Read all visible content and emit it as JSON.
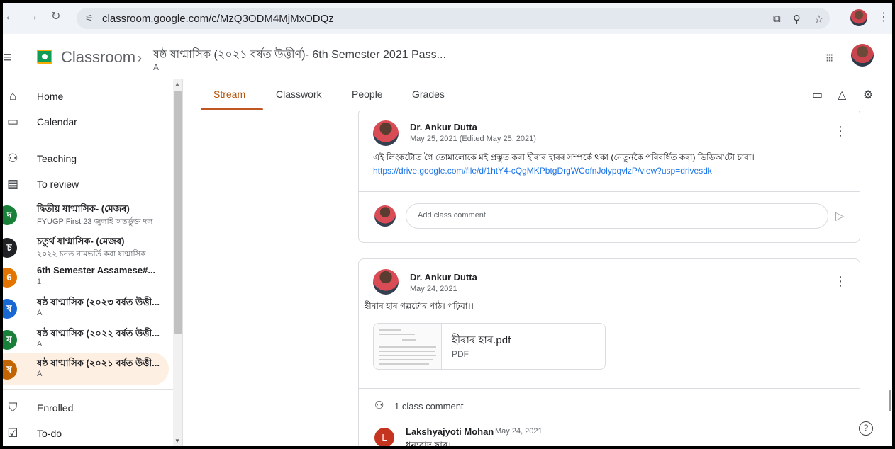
{
  "browser": {
    "url": "classroom.google.com/c/MzQ3ODM4MjMxODQz",
    "icons": [
      "back-icon",
      "forward-icon",
      "reload-icon",
      "site-info-icon",
      "cast-icon",
      "zoom-icon",
      "bookmark-star-icon",
      "profile-avatar",
      "menu-icon"
    ]
  },
  "header": {
    "app_title": "Classroom",
    "separator": "›",
    "class_title": "ষষ্ঠ ষাণ্মাসিক (২০২১ বৰ্ষত উত্তীৰ্ণ)- 6th Semester 2021 Pass...",
    "class_section": "A"
  },
  "sidebar": {
    "nav_top": [
      {
        "label": "Home",
        "icon": "home-icon"
      },
      {
        "label": "Calendar",
        "icon": "calendar-icon"
      }
    ],
    "teaching": {
      "label": "Teaching",
      "icon": "people-icon"
    },
    "to_review": {
      "label": "To review",
      "icon": "review-icon"
    },
    "classes": [
      {
        "letter": "দ",
        "title": "দ্বিতীয় ষাণ্মাসিক- (মেজৰ)",
        "subtitle": "FYUGP First 23 জুলাই অন্তৰ্ভুক্ত দল",
        "color": "#188038"
      },
      {
        "letter": "চ",
        "title": "চতুৰ্থ ষাণ্মাসিক- (মেজৰ)",
        "subtitle": "২০২২ চনত নামভৰ্তি কৰা ষাণ্মাসিক",
        "color": "#202124"
      },
      {
        "letter": "6",
        "title": "6th Semester Assamese#...",
        "subtitle": "1",
        "color": "#e37400"
      },
      {
        "letter": "ষ",
        "title": "ষষ্ঠ ষাণ্মাসিক (২০২৩ বৰ্ষত উত্তী...",
        "subtitle": "A",
        "color": "#1967d2"
      },
      {
        "letter": "ষ",
        "title": "ষষ্ঠ ষাণ্মাসিক (২০২২ বৰ্ষত উত্তী...",
        "subtitle": "A",
        "color": "#188038"
      },
      {
        "letter": "ষ",
        "title": "ষষ্ঠ ষাণ্মাসিক (২০২১ বৰ্ষত উত্তী...",
        "subtitle": "A",
        "color": "#c26401",
        "active": true
      }
    ],
    "nav_bottom": [
      {
        "label": "Enrolled",
        "icon": "graduation-cap-icon"
      },
      {
        "label": "To-do",
        "icon": "todo-icon"
      }
    ]
  },
  "tabs": [
    {
      "label": "Stream",
      "active": true
    },
    {
      "label": "Classwork"
    },
    {
      "label": "People"
    },
    {
      "label": "Grades"
    }
  ],
  "tab_icons": [
    "calendar-icon",
    "drive-icon",
    "settings-icon"
  ],
  "posts": [
    {
      "author": "Dr. Ankur Dutta",
      "date": "May 25, 2021 (Edited May 25, 2021)",
      "text": "এই লিংকটোত গৈ তোমালোকে মই প্ৰস্তুত কৰা হীৰাৰ হাৰৰ সম্পৰ্কে থকা (নেতুনকৈ পৰিবৰ্ধিত কৰা) ভিডিঅ'টো চাবা।",
      "link": "https://drive.google.com/file/d/1htY4-cQgMKPbtgDrgWCofnJolypqvlzP/view?usp=drivesdk",
      "comment_placeholder": "Add class comment..."
    },
    {
      "author": "Dr. Ankur Dutta",
      "date": "May 24, 2021",
      "text": "হীৰাৰ হাৰ গল্পটোৰ পাঠ। পঢ়িবা।।",
      "attachment": {
        "name": "হীৰাৰ হাৰ.pdf",
        "type": "PDF"
      },
      "comment_count": "1 class comment",
      "comment": {
        "initial": "L",
        "author": "Lakshyajyoti Mohan",
        "date": "May 24, 2021",
        "text": "ধন্যবাদ ছাৰ।"
      }
    }
  ],
  "help_label": "?"
}
